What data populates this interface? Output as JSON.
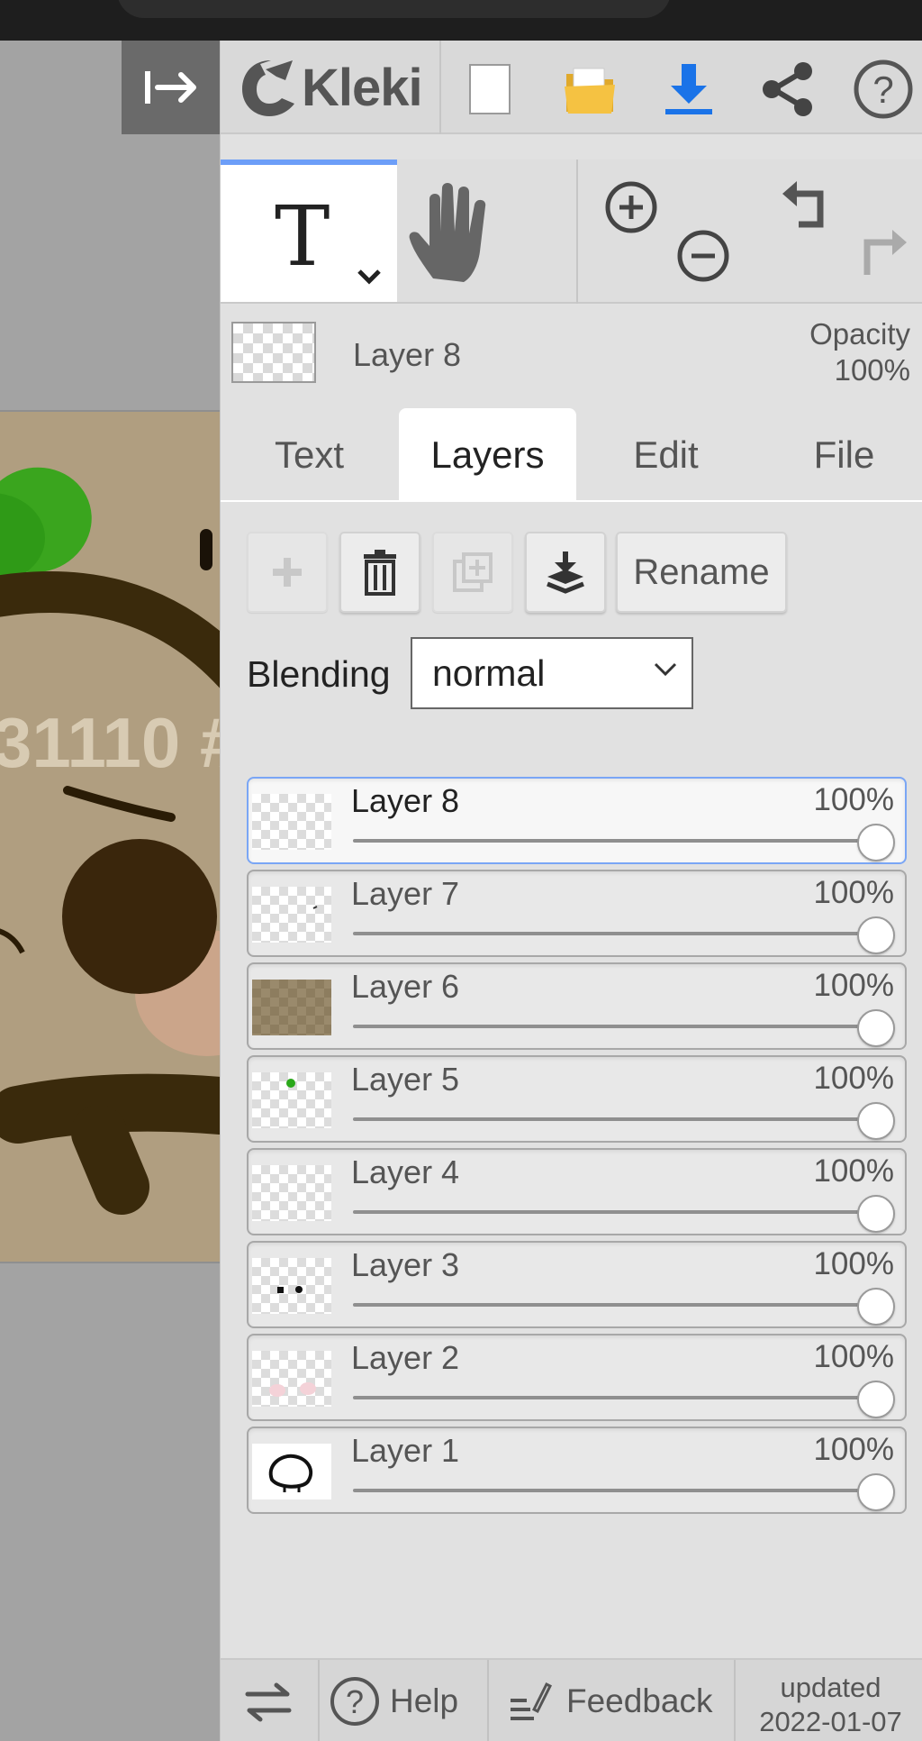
{
  "app": {
    "name": "Kleki"
  },
  "header": {
    "buttons": [
      "new-image",
      "open-image",
      "save-image",
      "share",
      "help"
    ],
    "colors": {
      "open": "#f5c242",
      "save": "#1a73e8"
    }
  },
  "toolbar": {
    "active_tool": "text-tool",
    "tools": [
      "text-tool",
      "hand-tool",
      "zoom-in",
      "zoom-out",
      "undo",
      "redo"
    ]
  },
  "current_layer": {
    "name": "Layer 8",
    "opacity_label": "Opacity",
    "opacity_value": "100%"
  },
  "tabs": [
    {
      "label": "Text",
      "active": false
    },
    {
      "label": "Layers",
      "active": true
    },
    {
      "label": "Edit",
      "active": false
    },
    {
      "label": "File",
      "active": false
    }
  ],
  "layer_buttons": {
    "rename_label": "Rename"
  },
  "blending": {
    "label": "Blending",
    "value": "normal"
  },
  "layers": [
    {
      "name": "Layer 8",
      "opacity": "100%",
      "opacity_value": 1.0,
      "selected": true
    },
    {
      "name": "Layer 7",
      "opacity": "100%",
      "opacity_value": 1.0,
      "selected": false
    },
    {
      "name": "Layer 6",
      "opacity": "100%",
      "opacity_value": 1.0,
      "selected": false
    },
    {
      "name": "Layer 5",
      "opacity": "100%",
      "opacity_value": 1.0,
      "selected": false
    },
    {
      "name": "Layer 4",
      "opacity": "100%",
      "opacity_value": 1.0,
      "selected": false
    },
    {
      "name": "Layer 3",
      "opacity": "100%",
      "opacity_value": 1.0,
      "selected": false
    },
    {
      "name": "Layer 2",
      "opacity": "100%",
      "opacity_value": 1.0,
      "selected": false
    },
    {
      "name": "Layer 1",
      "opacity": "100%",
      "opacity_value": 1.0,
      "selected": false
    }
  ],
  "canvas": {
    "visible_text": "31110 #"
  },
  "footer": {
    "help_label": "Help",
    "feedback_label": "Feedback",
    "updated_label": "updated",
    "updated_date": "2022-01-07"
  }
}
